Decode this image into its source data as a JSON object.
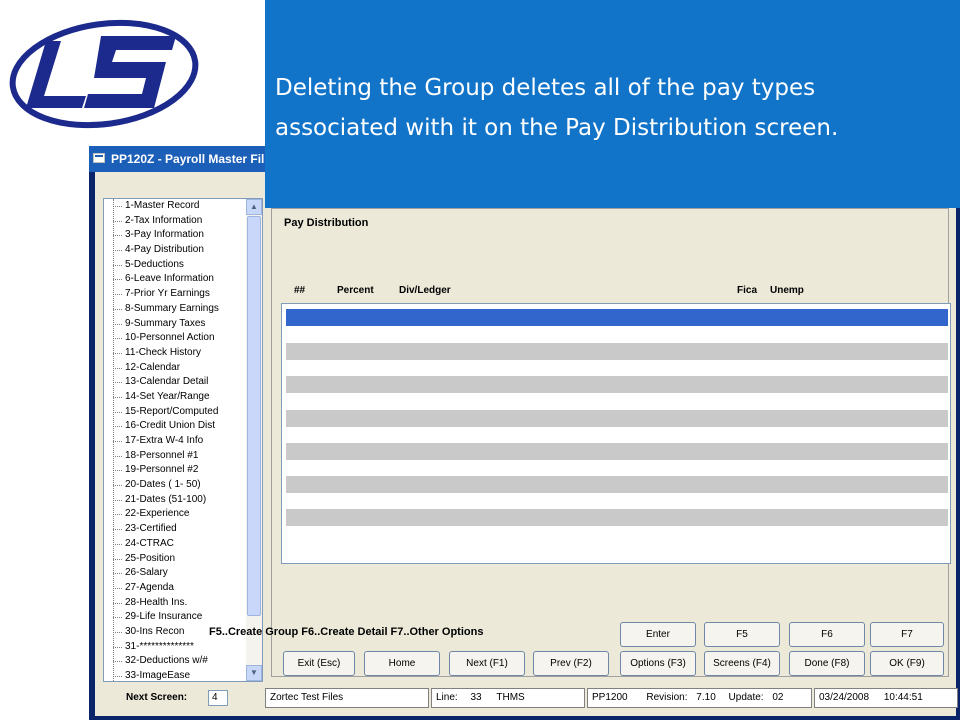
{
  "callout": {
    "text": "Deleting the Group deletes all of the pay types associated with it on the Pay Distribution screen."
  },
  "window": {
    "title": "PP120Z - Payroll Master Fil"
  },
  "tree": {
    "items": [
      "1-Master Record",
      "2-Tax Information",
      "3-Pay Information",
      "4-Pay Distribution",
      "5-Deductions",
      "6-Leave Information",
      "7-Prior Yr Earnings",
      "8-Summary Earnings",
      "9-Summary Taxes",
      "10-Personnel Action",
      "11-Check History",
      "12-Calendar",
      "13-Calendar Detail",
      "14-Set Year/Range",
      "15-Report/Computed",
      "16-Credit Union Dist",
      "17-Extra W-4 Info",
      "18-Personnel #1",
      "19-Personnel #2",
      "20-Dates ( 1- 50)",
      "21-Dates (51-100)",
      "22-Experience",
      "23-Certified",
      "24-CTRAC",
      "25-Position",
      "26-Salary",
      "27-Agenda",
      "28-Health Ins.",
      "29-Life Insurance",
      "30-Ins Recon",
      "31-**************",
      "32-Deductions w/#",
      "33-ImageEase"
    ]
  },
  "panel": {
    "title": "Pay Distribution",
    "columns": [
      "##",
      "Percent",
      "Div/Ledger",
      "Fica",
      "Unemp"
    ]
  },
  "function_note": "F5..Create Group  F6..Create Detail  F7..Other Options",
  "buttons_row1": [
    "Enter",
    "F5",
    "F6",
    "F7"
  ],
  "buttons_row2": [
    "Exit (Esc)",
    "Home",
    "Next (F1)",
    "Prev (F2)",
    "Options (F3)",
    "Screens (F4)",
    "Done (F8)",
    "OK (F9)"
  ],
  "status": {
    "next_screen_label": "Next Screen:",
    "next_screen_value": "4",
    "db_name": "Zortec Test Files",
    "line_label": "Line:",
    "line_value": "33",
    "user": "THMS",
    "program": "PP1200",
    "revision_label": "Revision:",
    "revision_value": "7.10",
    "update_label": "Update:",
    "update_value": "02",
    "date": "03/24/2008",
    "time": "10:44:51"
  },
  "colors": {
    "callout_bg": "#1174c8",
    "selected_row": "#3366cc",
    "logo_blue": "#1b2a8c"
  }
}
